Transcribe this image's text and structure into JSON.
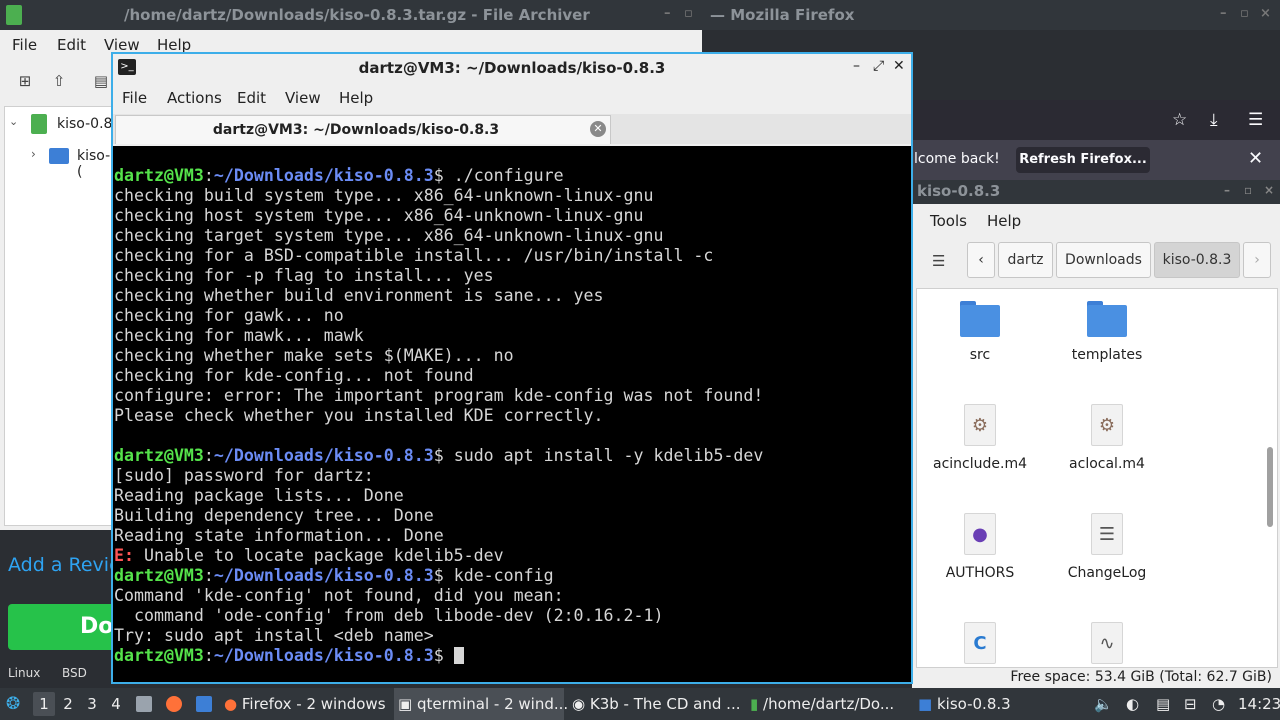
{
  "archiver": {
    "title": "/home/dartz/Downloads/kiso-0.8.3.tar.gz - File Archiver",
    "menu": [
      "File",
      "Edit",
      "View",
      "Help"
    ],
    "tree_root": "kiso-0.8",
    "tree_child": "kiso-("
  },
  "firefox": {
    "title": "— Mozilla Firefox",
    "notification": "lcome back!",
    "refresh_button": "Refresh Firefox..."
  },
  "file_manager": {
    "title": "kiso-0.8.3",
    "menu": [
      "Tools",
      "Help"
    ],
    "breadcrumbs": [
      "dartz",
      "Downloads",
      "kiso-0.8.3"
    ],
    "items": [
      {
        "name": "src",
        "type": "folder"
      },
      {
        "name": "templates",
        "type": "folder"
      },
      {
        "name": "acinclude.m4",
        "type": "gear-doc"
      },
      {
        "name": "aclocal.m4",
        "type": "gear-doc"
      },
      {
        "name": "AUTHORS",
        "type": "person-doc"
      },
      {
        "name": "ChangeLog",
        "type": "list-doc"
      },
      {
        "name": "",
        "type": "c-doc"
      },
      {
        "name": "",
        "type": "wave-doc"
      }
    ],
    "status": "Free space: 53.4 GiB (Total: 62.7 GiB)"
  },
  "web_left": {
    "review_text": "Add a Revie",
    "download_text": "Do",
    "os_labels": [
      "Linux",
      "BSD"
    ]
  },
  "terminal": {
    "title": "dartz@VM3: ~/Downloads/kiso-0.8.3",
    "menu": [
      "File",
      "Actions",
      "Edit",
      "View",
      "Help"
    ],
    "tab_title": "dartz@VM3: ~/Downloads/kiso-0.8.3",
    "prompt_user": "dartz@VM3",
    "prompt_path": "~/Downloads/kiso-0.8.3",
    "lines": [
      {
        "kind": "prompt",
        "cmd": " ./configure"
      },
      {
        "kind": "out",
        "text": "checking build system type... x86_64-unknown-linux-gnu"
      },
      {
        "kind": "out",
        "text": "checking host system type... x86_64-unknown-linux-gnu"
      },
      {
        "kind": "out",
        "text": "checking target system type... x86_64-unknown-linux-gnu"
      },
      {
        "kind": "out",
        "text": "checking for a BSD-compatible install... /usr/bin/install -c"
      },
      {
        "kind": "out",
        "text": "checking for -p flag to install... yes"
      },
      {
        "kind": "out",
        "text": "checking whether build environment is sane... yes"
      },
      {
        "kind": "out",
        "text": "checking for gawk... no"
      },
      {
        "kind": "out",
        "text": "checking for mawk... mawk"
      },
      {
        "kind": "out",
        "text": "checking whether make sets $(MAKE)... no"
      },
      {
        "kind": "out",
        "text": "checking for kde-config... not found"
      },
      {
        "kind": "out",
        "text": "configure: error: The important program kde-config was not found!"
      },
      {
        "kind": "out",
        "text": "Please check whether you installed KDE correctly."
      },
      {
        "kind": "out",
        "text": ""
      },
      {
        "kind": "prompt",
        "cmd": " sudo apt install -y kdelib5-dev"
      },
      {
        "kind": "out",
        "text": "[sudo] password for dartz:"
      },
      {
        "kind": "out",
        "text": "Reading package lists... Done"
      },
      {
        "kind": "out",
        "text": "Building dependency tree... Done"
      },
      {
        "kind": "out",
        "text": "Reading state information... Done"
      },
      {
        "kind": "error",
        "tag": "E:",
        "text": " Unable to locate package kdelib5-dev"
      },
      {
        "kind": "prompt",
        "cmd": " kde-config"
      },
      {
        "kind": "out",
        "text": "Command 'kde-config' not found, did you mean:"
      },
      {
        "kind": "out",
        "text": "  command 'ode-config' from deb libode-dev (2:0.16.2-1)"
      },
      {
        "kind": "out",
        "text": "Try: sudo apt install <deb name>"
      },
      {
        "kind": "prompt",
        "cmd": " ",
        "cursor": true
      }
    ]
  },
  "taskbar": {
    "workspaces": [
      "1",
      "2",
      "3",
      "4"
    ],
    "tasks": [
      {
        "label": "Firefox - 2 windows"
      },
      {
        "label": "qterminal - 2 wind..."
      },
      {
        "label": "K3b - The CD and ..."
      },
      {
        "label": "/home/dartz/Do..."
      },
      {
        "label": "kiso-0.8.3"
      }
    ],
    "clock": "14:23"
  },
  "colors": {
    "terminal_user": "#55e34b",
    "terminal_path": "#6b8cf5",
    "terminal_error": "#ff5555",
    "active_border": "#3daee9",
    "download_button": "#26c24a"
  }
}
